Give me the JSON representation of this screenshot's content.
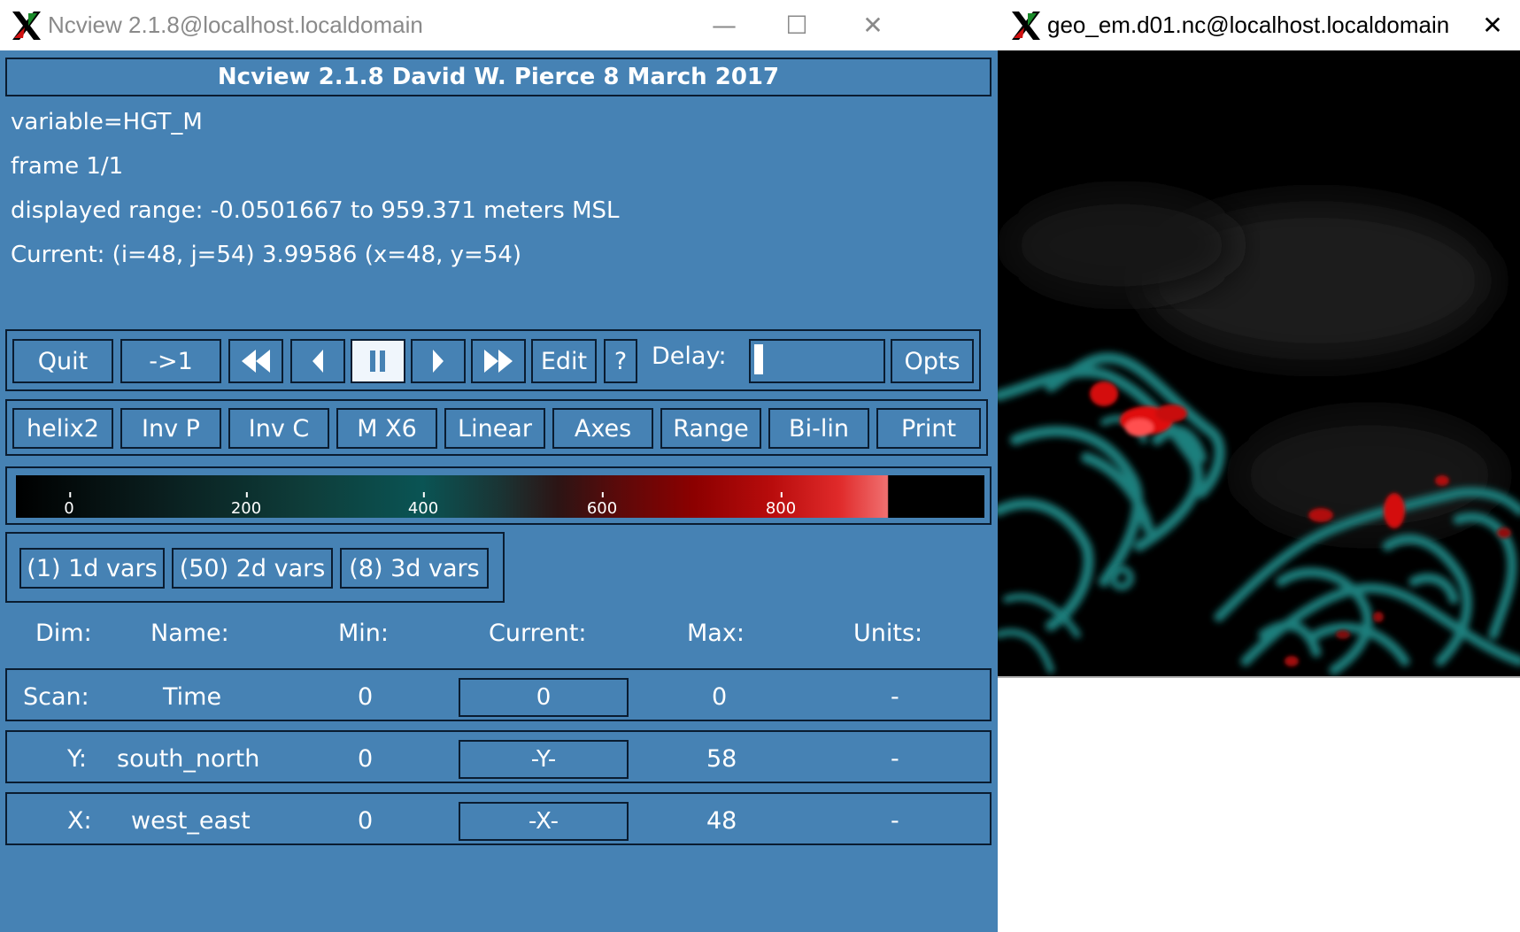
{
  "main_window": {
    "title": "Ncview 2.1.8@localhost.localdomain",
    "banner": "Ncview 2.1.8 David W. Pierce  8 March 2017",
    "variable": "variable=HGT_M",
    "frame": "frame 1/1",
    "displayed_range": "displayed range: -0.0501667 to 959.371 meters MSL",
    "current": "Current: (i=48, j=54) 3.99586 (x=48, y=54)"
  },
  "controls": {
    "quit": "Quit",
    "goto_first": "->1",
    "rewind_icon": "fast-rewind-icon",
    "back_icon": "step-back-icon",
    "pause_icon": "pause-icon",
    "forward_icon": "step-forward-icon",
    "fast_forward_icon": "fast-forward-icon",
    "edit": "Edit",
    "help": "?",
    "delay_label": "Delay:",
    "opts": "Opts"
  },
  "options": {
    "colormap": "helix2",
    "inv_p": "Inv P",
    "inv_c": "Inv C",
    "magnify": "M X6",
    "linear": "Linear",
    "axes": "Axes",
    "range": "Range",
    "bilin": "Bi-lin",
    "print": "Print"
  },
  "colorbar": {
    "ticks": [
      "0",
      "200",
      "400",
      "600",
      "800"
    ],
    "colors": [
      "#000000",
      "#0a5454",
      "#8c0000",
      "#f07070"
    ]
  },
  "var_groups": {
    "one_d": "(1) 1d vars",
    "two_d": "(50) 2d vars",
    "three_d": "(8) 3d vars"
  },
  "dims": {
    "headers": {
      "dim": "Dim:",
      "name": "Name:",
      "min": "Min:",
      "current": "Current:",
      "max": "Max:",
      "units": "Units:"
    },
    "rows": [
      {
        "dim": "Scan:",
        "name": "Time",
        "min": "0",
        "current": "0",
        "max": "0",
        "units": "-"
      },
      {
        "dim": "Y:",
        "name": "south_north",
        "min": "0",
        "current": "-Y-",
        "max": "58",
        "units": "-"
      },
      {
        "dim": "X:",
        "name": "west_east",
        "min": "0",
        "current": "-X-",
        "max": "48",
        "units": "-"
      }
    ]
  },
  "image_window": {
    "title": "geo_em.d01.nc@localhost.localdomain"
  },
  "theme": {
    "panel_bg": "#4682b4",
    "border": "#0a1c30",
    "teal": "#1e7c7c",
    "red": "#e01010"
  }
}
